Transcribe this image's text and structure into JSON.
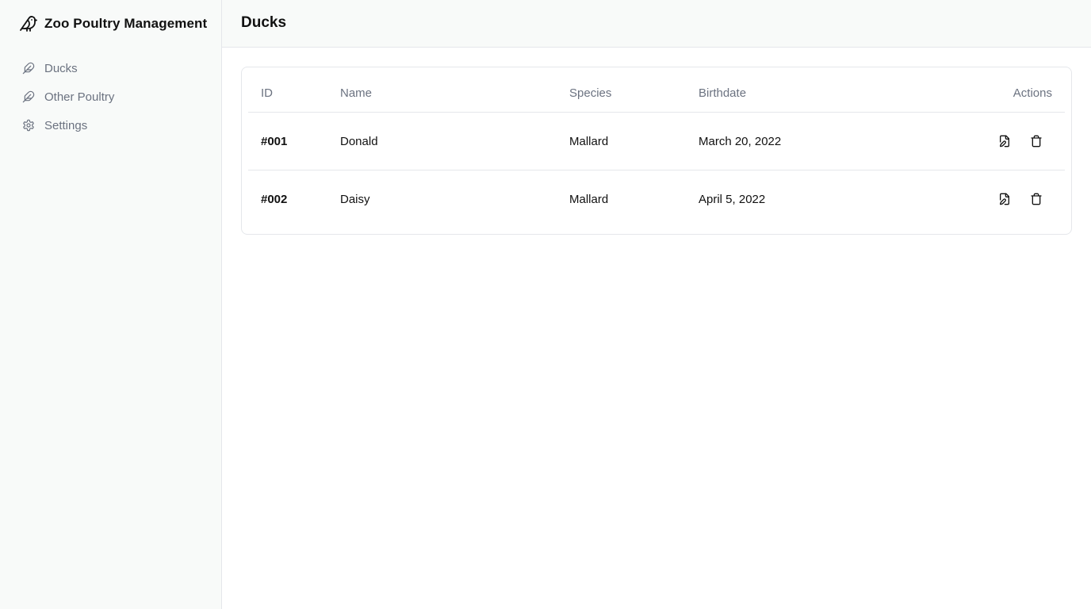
{
  "app": {
    "title": "Zoo Poultry Management",
    "brand_icon": "bird-icon"
  },
  "sidebar": {
    "items": [
      {
        "label": "Ducks",
        "icon": "feather-icon"
      },
      {
        "label": "Other Poultry",
        "icon": "feather-icon"
      },
      {
        "label": "Settings",
        "icon": "gear-icon"
      }
    ]
  },
  "header": {
    "title": "Ducks"
  },
  "table": {
    "columns": [
      "ID",
      "Name",
      "Species",
      "Birthdate",
      "Actions"
    ],
    "rows": [
      {
        "id": "#001",
        "name": "Donald",
        "species": "Mallard",
        "birthdate": "March 20, 2022"
      },
      {
        "id": "#002",
        "name": "Daisy",
        "species": "Mallard",
        "birthdate": "April 5, 2022"
      }
    ],
    "action_icons": [
      "edit-file-icon",
      "trash-icon"
    ]
  },
  "colors": {
    "sidebar_bg": "#f8faf9",
    "border": "#e5e7eb",
    "muted_text": "#6b7280",
    "text": "#111111"
  }
}
